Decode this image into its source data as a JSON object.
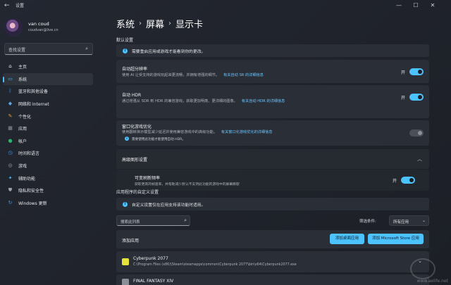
{
  "window": {
    "title": "设置",
    "back_glyph": "←",
    "minimize_glyph": "—",
    "maximize_glyph": "☐",
    "close_glyph": "✕"
  },
  "user": {
    "name": "van coud",
    "email": "coudvan@live.cn"
  },
  "search": {
    "placeholder": "查找设置",
    "icon": "search-icon"
  },
  "sidebar": {
    "items": [
      {
        "label": "主页",
        "icon": "home-icon",
        "color": "#e8e8e8",
        "glyph": "⌂"
      },
      {
        "label": "系统",
        "icon": "system-icon",
        "color": "#4cc2ff",
        "glyph": "▭",
        "active": true
      },
      {
        "label": "蓝牙和其他设备",
        "icon": "bluetooth-icon",
        "color": "#3b8ee8",
        "glyph": "ᛒ"
      },
      {
        "label": "网络和 Internet",
        "icon": "network-icon",
        "color": "#5aa9e6",
        "glyph": "◆"
      },
      {
        "label": "个性化",
        "icon": "personalization-icon",
        "color": "#e8a23a",
        "glyph": "✎"
      },
      {
        "label": "应用",
        "icon": "apps-icon",
        "color": "#8d96a3",
        "glyph": "▦"
      },
      {
        "label": "帐户",
        "icon": "accounts-icon",
        "color": "#2fb36b",
        "glyph": "●"
      },
      {
        "label": "时间和语言",
        "icon": "time-language-icon",
        "color": "#4c9be8",
        "glyph": "◷"
      },
      {
        "label": "游戏",
        "icon": "gaming-icon",
        "color": "#9aa1ab",
        "glyph": "◎"
      },
      {
        "label": "辅助功能",
        "icon": "accessibility-icon",
        "color": "#5ab0ee",
        "glyph": "✦"
      },
      {
        "label": "隐私和安全性",
        "icon": "privacy-icon",
        "color": "#9aa1ab",
        "glyph": "⛊"
      },
      {
        "label": "Windows 更新",
        "icon": "windows-update-icon",
        "color": "#4c9be8",
        "glyph": "↻"
      }
    ]
  },
  "breadcrumb": {
    "part1": "系统",
    "part2": "屏幕",
    "part3": "显示卡",
    "sep": "›"
  },
  "default_settings": {
    "heading": "默认设置",
    "restart_notice": "需要重启应用或游戏才能看到你的更改。",
    "auto_sr": {
      "title": "自动超分辨率",
      "desc": "使用 AI 让受支持的游戏玩起来更流畅，并拥有增强的细节。",
      "link": "有关自动 SR 的详细信息",
      "state": "开"
    },
    "auto_hdr": {
      "title": "自动 HDR",
      "desc": "通过增强从 SDR 到 HDR 的兼容游戏，获取更加明亮、更详细的图像。",
      "link": "有关自动 HDR 的详细信息",
      "state": "开"
    },
    "windowed_opt": {
      "title": "窗口化游戏优化",
      "desc": "使用翻转演示模型减少延迟并使用兼容游戏中的高级功能。",
      "link": "有关窗口化游戏优化的详细信息",
      "note": "需要使用此功能才能使用自动 HDR。"
    }
  },
  "advanced": {
    "heading": "高级图形设置",
    "vrr_title": "可变刷新频率",
    "vrr_desc": "获取更高的帧速率，并帮助减少默认不支持此功能的游戏中的屏幕撕裂",
    "vrr_state": "开"
  },
  "custom": {
    "heading": "应用程序的自定义设置",
    "notice": "自定义设置仅在应用支持该功能时适用。",
    "filter_placeholder": "搜索此列表",
    "filter_label": "筛选条件:",
    "filter_value": "所有应用",
    "add_app_label": "添加应用",
    "add_desktop_btn": "添加桌面应用",
    "add_store_btn": "添加 Microsoft Store 应用",
    "apps": [
      {
        "name": "Cyberpunk 2077",
        "path": "C:\\Program Files (x86)\\Steam\\steamapps\\common\\Cyberpunk 2077\\bin\\x64\\Cyberpunk2077.exe"
      },
      {
        "name": "FINAL FANTASY XIV",
        "path": ""
      }
    ]
  },
  "watermark": "www.aelife.net"
}
